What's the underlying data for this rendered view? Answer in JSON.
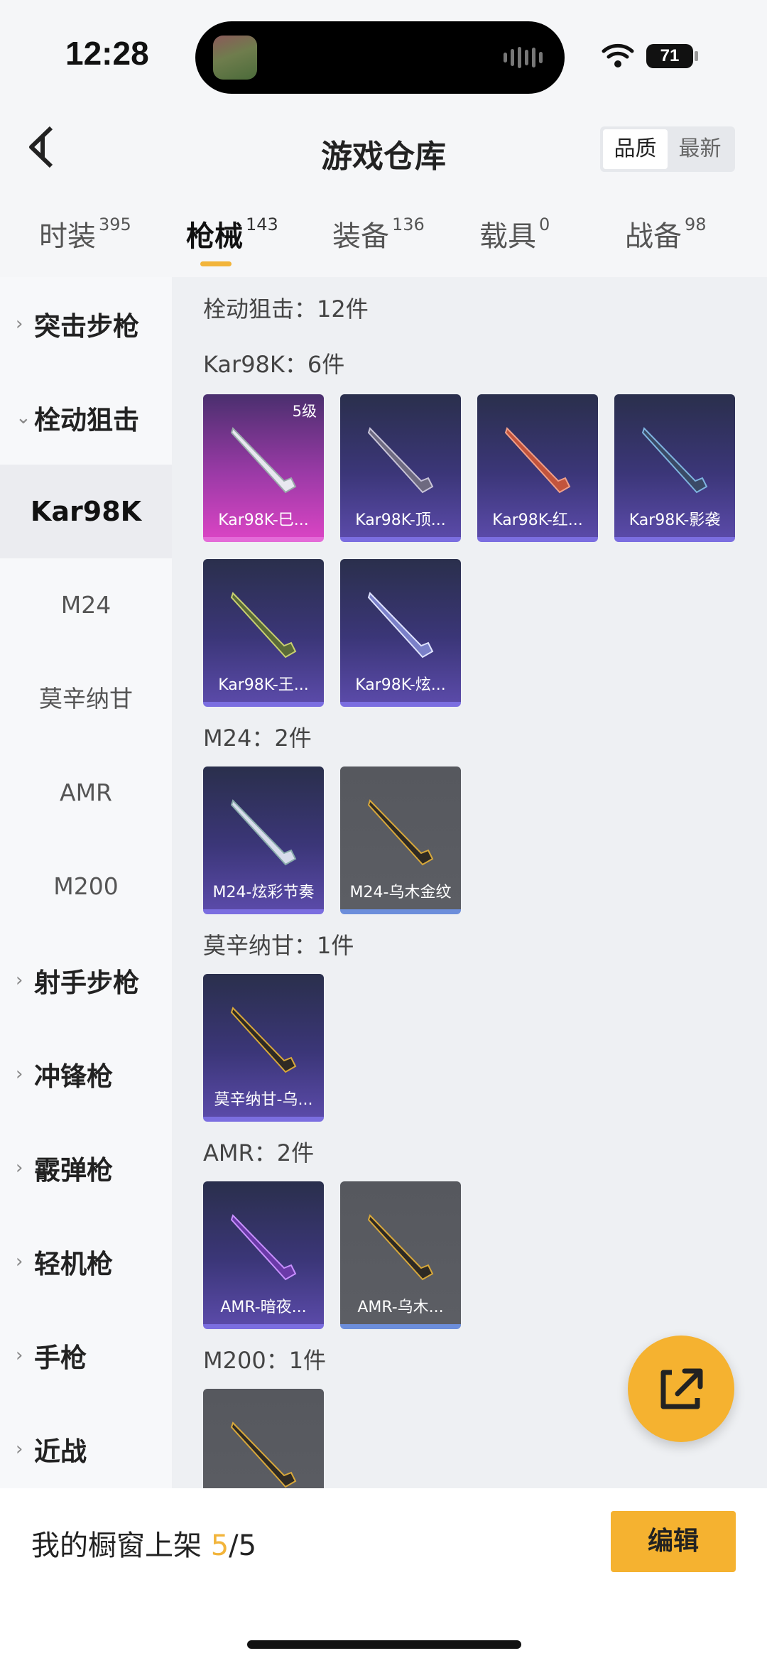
{
  "status": {
    "time": "12:28",
    "battery": "71"
  },
  "header": {
    "title": "游戏仓库",
    "sort_options": [
      "品质",
      "最新"
    ]
  },
  "tabs": [
    {
      "label": "时装",
      "count": "395"
    },
    {
      "label": "枪械",
      "count": "143"
    },
    {
      "label": "装备",
      "count": "136"
    },
    {
      "label": "载具",
      "count": "0"
    },
    {
      "label": "战备",
      "count": "98"
    }
  ],
  "sidebar": {
    "categories": [
      "突击步枪",
      "栓动狙击",
      "射手步枪",
      "冲锋枪",
      "霰弹枪",
      "轻机枪",
      "手枪",
      "近战"
    ],
    "subitems": [
      "Kar98K",
      "M24",
      "莫辛纳甘",
      "AMR",
      "M200"
    ]
  },
  "main": {
    "section_title": "栓动狙击：12件",
    "groups": [
      {
        "title": "Kar98K：6件",
        "items": [
          {
            "name": "Kar98K-巳...",
            "level": "5级",
            "color": "#d844c3"
          },
          {
            "name": "Kar98K-顶...",
            "color": "#5a4aa8"
          },
          {
            "name": "Kar98K-红...",
            "color": "#5a4aa8"
          },
          {
            "name": "Kar98K-影袭",
            "color": "#5a4aa8"
          },
          {
            "name": "Kar98K-王...",
            "color": "#5a4aa8"
          },
          {
            "name": "Kar98K-炫...",
            "color": "#5a4aa8"
          }
        ]
      },
      {
        "title": "M24：2件",
        "items": [
          {
            "name": "M24-炫彩节奏",
            "color": "#5a4aa8"
          },
          {
            "name": "M24-乌木金纹",
            "color": "#5c5e64"
          }
        ]
      },
      {
        "title": "莫辛纳甘：1件",
        "items": [
          {
            "name": "莫辛纳甘-乌...",
            "color": "#5a4aa8"
          }
        ]
      },
      {
        "title": "AMR：2件",
        "items": [
          {
            "name": "AMR-暗夜...",
            "color": "#5a4aa8"
          },
          {
            "name": "AMR-乌木...",
            "color": "#5c5e64"
          }
        ]
      },
      {
        "title": "M200：1件",
        "items": []
      }
    ]
  },
  "bottom": {
    "label": "我的橱窗上架 ",
    "current": "5",
    "total": "/5",
    "edit_label": "编辑"
  },
  "colors": {
    "accent": "#f5b230"
  }
}
